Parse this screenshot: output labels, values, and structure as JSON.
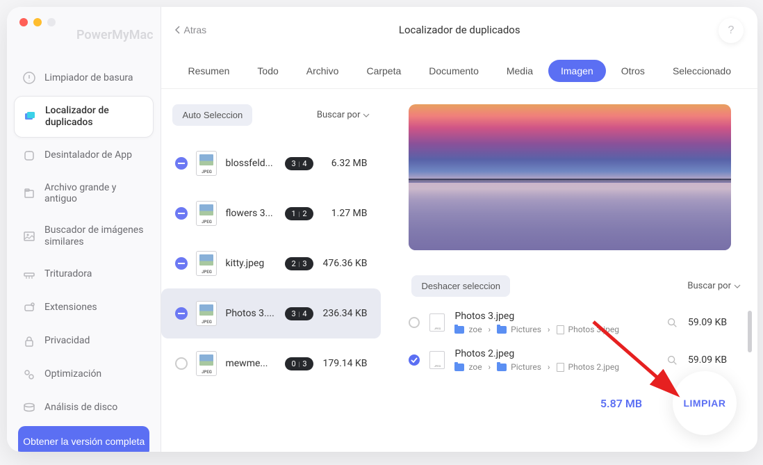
{
  "brand": "PowerMyMac",
  "back_label": "Atras",
  "title": "Localizador de duplicados",
  "help_label": "?",
  "sidebar": {
    "items": [
      {
        "label": "Limpiador de basura",
        "icon": "trash-icon"
      },
      {
        "label": "Localizador de duplicados",
        "icon": "duplicate-icon",
        "active": true
      },
      {
        "label": "Desintalador de App",
        "icon": "uninstall-icon"
      },
      {
        "label": "Archivo grande y antiguo",
        "icon": "large-file-icon"
      },
      {
        "label": "Buscador de imágenes similares",
        "icon": "similar-image-icon"
      },
      {
        "label": "Trituradora",
        "icon": "shredder-icon"
      },
      {
        "label": "Extensiones",
        "icon": "extensions-icon"
      },
      {
        "label": "Privacidad",
        "icon": "privacy-icon"
      },
      {
        "label": "Optimización",
        "icon": "optimize-icon"
      },
      {
        "label": "Análisis de disco",
        "icon": "disk-icon"
      }
    ],
    "cta": "Obtener la versión completa"
  },
  "tabs": [
    {
      "label": "Resumen"
    },
    {
      "label": "Todo"
    },
    {
      "label": "Archivo"
    },
    {
      "label": "Carpeta"
    },
    {
      "label": "Documento"
    },
    {
      "label": "Media"
    },
    {
      "label": "Imagen",
      "active": true
    },
    {
      "label": "Otros"
    },
    {
      "label": "Seleccionado"
    }
  ],
  "left": {
    "auto_select": "Auto Seleccion",
    "search_by": "Buscar por",
    "groups": [
      {
        "name": "blossfeld...",
        "ext": "JPEG",
        "selected_count": "3",
        "total_count": "4",
        "size": "6.32 MB",
        "state": "partial"
      },
      {
        "name": "flowers 3...",
        "ext": "JPEG",
        "selected_count": "1",
        "total_count": "2",
        "size": "1.27 MB",
        "state": "partial"
      },
      {
        "name": "kitty.jpeg",
        "ext": "JPEG",
        "selected_count": "2",
        "total_count": "3",
        "size": "476.36 KB",
        "state": "partial"
      },
      {
        "name": "Photos 3....",
        "ext": "JPEG",
        "selected_count": "3",
        "total_count": "4",
        "size": "236.34 KB",
        "state": "partial",
        "hl": true
      },
      {
        "name": "mewme...",
        "ext": "JPEG",
        "selected_count": "0",
        "total_count": "3",
        "size": "179.14 KB",
        "state": "none"
      }
    ]
  },
  "right": {
    "undo_label": "Deshacer seleccion",
    "search_by": "Buscar por",
    "items": [
      {
        "name": "Photos 3.jpeg",
        "checked": false,
        "size": "59.09 KB",
        "path": [
          {
            "type": "folder",
            "name": "zoe"
          },
          {
            "type": "folder",
            "name": "Pictures"
          },
          {
            "type": "file",
            "name": "Photos 3.jpeg"
          }
        ]
      },
      {
        "name": "Photos 2.jpeg",
        "checked": true,
        "size": "59.09 KB",
        "path": [
          {
            "type": "folder",
            "name": "zoe"
          },
          {
            "type": "folder",
            "name": "Pictures"
          },
          {
            "type": "file",
            "name": "Photos 2.jpeg"
          }
        ]
      }
    ]
  },
  "footer": {
    "total": "5.87 MB",
    "clean": "LIMPIAR"
  }
}
